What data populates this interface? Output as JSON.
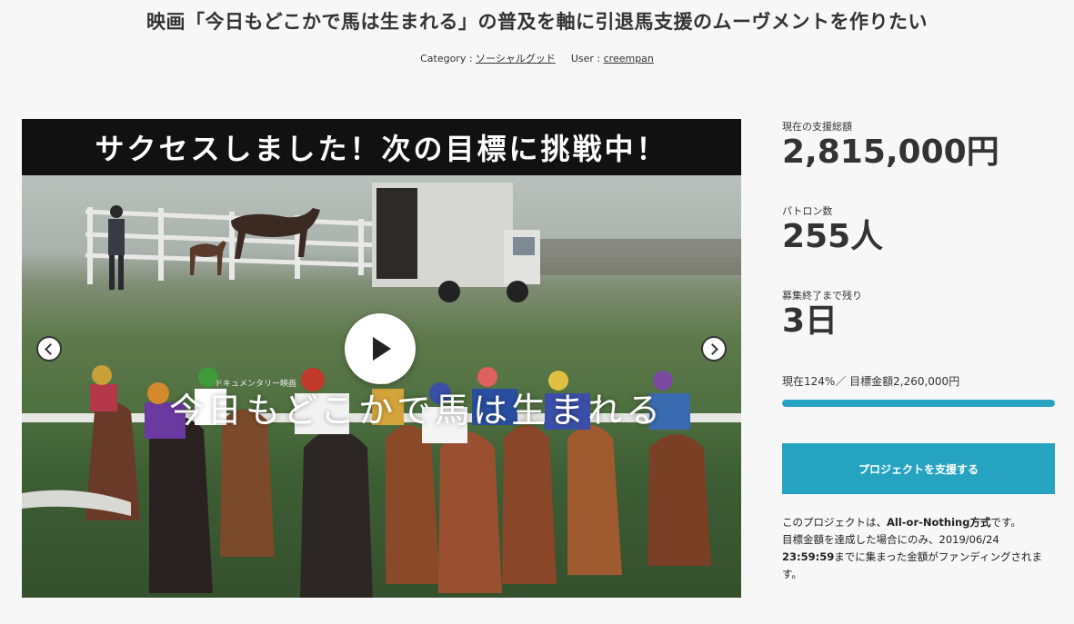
{
  "header": {
    "title": "映画「今日もどこかで馬は生まれる」の普及を軸に引退馬支援のムーヴメントを作りたい",
    "category_prefix": "Category : ",
    "category": "ソーシャルグッド",
    "user_prefix": "User : ",
    "user": "creempan"
  },
  "media": {
    "banner": "サクセスしました！次の目標に挑戦中！",
    "overlay_small": "ドキュメンタリー映画",
    "overlay_title": "今日もどこかで馬は生まれる"
  },
  "stats": {
    "total_label": "現在の支援総額",
    "total_value": "2,815,000円",
    "patrons_label": "パトロン数",
    "patrons_value": "255人",
    "remaining_label": "募集終了まで残り",
    "remaining_value": "3日",
    "progress_text": "現在124%／ 目標金額2,260,000円",
    "progress_percent": 124
  },
  "cta": {
    "support_label": "プロジェクトを支援する"
  },
  "note": {
    "line1_a": "このプロジェクトは、",
    "line1_b": "All-or-Nothing方式",
    "line1_c": "です。",
    "line2": "目標金額を達成した場合にのみ、2019/06/24",
    "line3_a": "23:59:59",
    "line3_b": "までに集まった金額がファンディングされま",
    "line4": "す。"
  },
  "colors": {
    "accent": "#26a3c1"
  }
}
